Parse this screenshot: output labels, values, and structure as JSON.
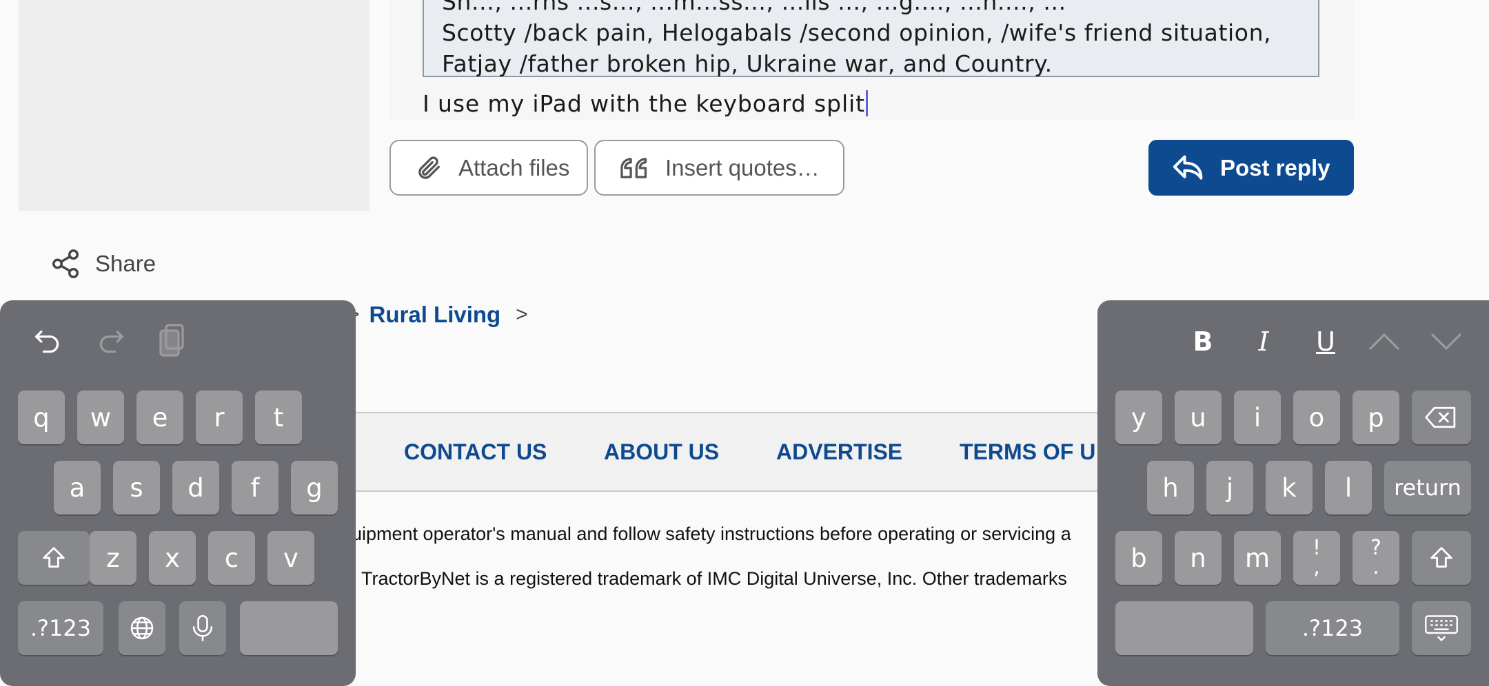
{
  "editor": {
    "quote_lines": [
      "Sn..., ...rns ...s..., ...m...ss..., ...lls ..., ...g...., ...n...., ...",
      "Scotty /back pain, Helogabals /second opinion, /wife's friend situation,",
      "Fatjay /father broken hip, Ukraine war, and Country."
    ],
    "typed_text": "I use my iPad with the keyboard split"
  },
  "toolbar": {
    "attach_label": "Attach files",
    "insert_quotes_label": "Insert quotes…",
    "post_reply_label": "Post reply"
  },
  "share": {
    "label": "Share"
  },
  "breadcrumb": {
    "item": "Rural Living"
  },
  "footer": {
    "nav": [
      "CONTACT US",
      "ABOUT US",
      "ADVERTISE",
      "TERMS OF U"
    ],
    "safety_text": "uipment operator's manual and follow safety instructions before operating or servicing a",
    "trademark_text": "| TractorByNet is a registered trademark of IMC Digital Universe, Inc. Other trademarks"
  },
  "keyboard_left": {
    "row1": [
      "q",
      "w",
      "e",
      "r",
      "t"
    ],
    "row2": [
      "a",
      "s",
      "d",
      "f",
      "g"
    ],
    "row3": [
      "z",
      "x",
      "c",
      "v"
    ],
    "numbers_key": ".?123"
  },
  "keyboard_right": {
    "format": {
      "bold": "B",
      "italic": "I",
      "underline": "U"
    },
    "row1": [
      "y",
      "u",
      "i",
      "o",
      "p"
    ],
    "row2": [
      "h",
      "j",
      "k",
      "l"
    ],
    "return_key": "return",
    "row3": [
      "b",
      "n",
      "m"
    ],
    "punct1": {
      "top": "!",
      "bottom": ","
    },
    "punct2": {
      "top": "?",
      "bottom": "."
    },
    "numbers_key": ".?123"
  },
  "colors": {
    "brand_blue": "#0e4a8f",
    "keyboard_bg": "#6c6d72",
    "key_bg": "#9a9a9c"
  }
}
